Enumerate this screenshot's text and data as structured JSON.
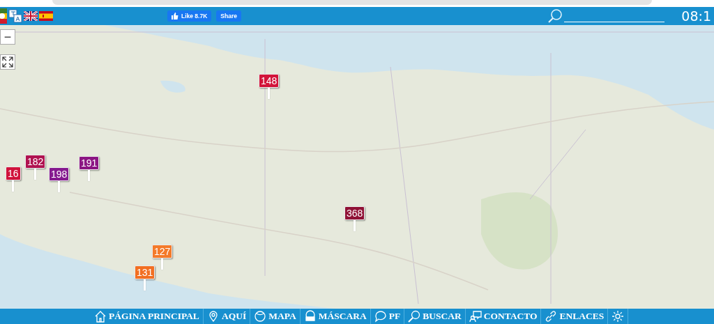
{
  "header": {
    "like_button": "Like 8.7K",
    "share_button": "Share",
    "clock": "08:1"
  },
  "map_controls": {
    "zoom_out": "−"
  },
  "markers": [
    {
      "label": "16",
      "color": "#d0133c"
    },
    {
      "label": "182",
      "color": "#b01250"
    },
    {
      "label": "198",
      "color": "#851a8f"
    },
    {
      "label": "191",
      "color": "#8b1583"
    },
    {
      "label": "148",
      "color": "#d2143a"
    },
    {
      "label": "368",
      "color": "#901236"
    },
    {
      "label": "127",
      "color": "#f47a2a"
    },
    {
      "label": "131",
      "color": "#f26f22"
    }
  ],
  "nav": [
    {
      "label": "PÁGINA PRINCIPAL",
      "kind": "home"
    },
    {
      "label": "AQUÍ",
      "kind": "pin"
    },
    {
      "label": "MAPA",
      "kind": "globe"
    },
    {
      "label": "MÁSCARA",
      "kind": "mask"
    },
    {
      "label": "PF",
      "kind": "faq"
    },
    {
      "label": "BUSCAR",
      "kind": "search"
    },
    {
      "label": "CONTACTO",
      "kind": "contact"
    },
    {
      "label": "ENLACES",
      "kind": "link"
    },
    {
      "kind": "gear"
    }
  ]
}
